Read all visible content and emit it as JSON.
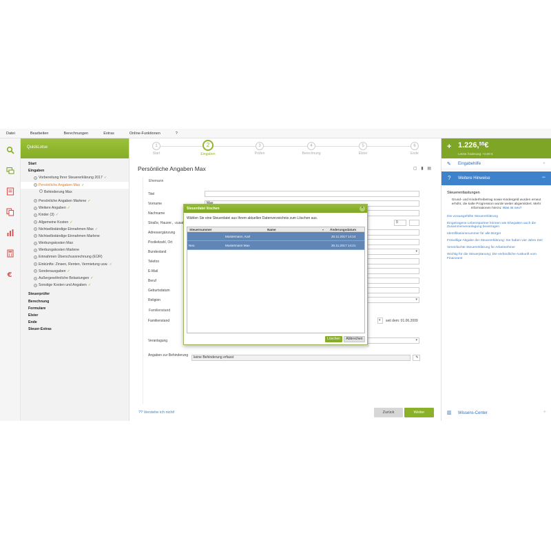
{
  "menu": [
    "Datei",
    "Bearbeiten",
    "Berechnungen",
    "Extras",
    "Online-Funktionen",
    "?"
  ],
  "rail_icons": [
    "search-icon",
    "chat-icon",
    "form-icon",
    "copy-icon",
    "chart-icon",
    "calculator-icon",
    "euro-icon"
  ],
  "tree": {
    "header": "QuickLotse",
    "items": [
      {
        "label": "Start",
        "type": "bold"
      },
      {
        "label": "Eingaben",
        "type": "bold"
      },
      {
        "label": "Vorbereitung Ihrer Steuererklärung 2017",
        "type": "sub",
        "check": true
      },
      {
        "label": "Persönliche Angaben Max",
        "type": "sub",
        "check": true,
        "selected": true
      },
      {
        "label": "Behinderung Max",
        "type": "sub2"
      },
      {
        "label": "Persönliche Angaben Marlene",
        "type": "sub",
        "check": true,
        "gap": true
      },
      {
        "label": "Weitere Angaben",
        "type": "sub",
        "check": true
      },
      {
        "label": "Kinder (3)",
        "type": "sub",
        "check": true
      },
      {
        "label": "Allgemeine Kosten",
        "type": "sub",
        "check": true
      },
      {
        "label": "Nichtselbständige Einnahmen Max",
        "type": "sub",
        "check": true
      },
      {
        "label": "Nichtselbständige Einnahmen Marlene",
        "type": "sub"
      },
      {
        "label": "Werbungskosten Max",
        "type": "sub"
      },
      {
        "label": "Werbungskosten Marlene",
        "type": "sub"
      },
      {
        "label": "Einnahmen Überschussrechnung (EÜR)",
        "type": "sub"
      },
      {
        "label": "Einkünfte: Zinsen, Renten, Vermietung usw.",
        "type": "sub",
        "check": true
      },
      {
        "label": "Sonderausgaben",
        "type": "sub",
        "check": true
      },
      {
        "label": "Außergewöhnliche Belastungen",
        "type": "sub",
        "check": true
      },
      {
        "label": "Sonstige Kosten und Angaben",
        "type": "sub",
        "check": true
      },
      {
        "label": "Steuerprüfer",
        "type": "bold",
        "gap": true
      },
      {
        "label": "Berechnung",
        "type": "bold"
      },
      {
        "label": "Formulare",
        "type": "bold"
      },
      {
        "label": "Elster",
        "type": "bold"
      },
      {
        "label": "Ende",
        "type": "bold"
      },
      {
        "label": "Steuer-Extras",
        "type": "bold"
      }
    ]
  },
  "steps": [
    {
      "num": "1",
      "label": "Start"
    },
    {
      "num": "2",
      "label": "Eingaben",
      "active": true
    },
    {
      "num": "3",
      "label": "Prüfen"
    },
    {
      "num": "4",
      "label": "Berechnung"
    },
    {
      "num": "5",
      "label": "Elster"
    },
    {
      "num": "6",
      "label": "Ende"
    }
  ],
  "page_title": "Persönliche Angaben Max",
  "form": {
    "section_ehemann": "Ehemann",
    "labels": [
      "Titel",
      "Vorname",
      "Nachname",
      "Straße, Hausnr., -zusatz",
      "Adressergänzung",
      "Postleitzahl, Ort",
      "Bundesland",
      "Telefon",
      "E-Mail",
      "Beruf",
      "Geburtsdatum",
      "Religion"
    ],
    "vorname_value": "Max",
    "hausnr_value": "0",
    "section_familienstand": "Familienstand",
    "familienstand_label": "Familienstand",
    "seit_text": "seit dem: 01.06.2009",
    "veranlagung_label": "Veranlagung",
    "behinderung_label": "Angaben zur Behinderung",
    "behinderung_value": "keine Behinderung erfasst"
  },
  "help_link": "Verstehe ich nicht!",
  "buttons": {
    "back": "Zurück",
    "next": "Weiter"
  },
  "refund": {
    "amount_main": "1.226,",
    "amount_cents": "55",
    "currency": "€",
    "last_change": "Letzte Änderung: +0,00 €"
  },
  "right": {
    "eingabehilfe": "Eingabehilfe",
    "weitere_hinweise": "Weitere Hinweise",
    "steuerentlastungen": "Steuerentlastungen",
    "paragraph": "Grund- und Kinderfreibetrag sowie Kindergeld wurden erneut erhöht, die kalte Progression wurde weiter abgemildert. Mehr Informationen hierzu:",
    "paragraph_link": "Was ist neu?",
    "links": [
      "Die vorausgefüllte Steuererklärung",
      "Eingetragene Lebenspartner können wie Ehegatten auch die Zusammenveranlagung beantragen",
      "Identifikationsnummer für alle Bürger",
      "Freiwillige Abgabe der Steuererklärung: Sie haben vier Jahre Zeit",
      "Vereinfachte Steuererklärung für Arbeitnehmer",
      "Wichtig für die Steuerplanung: Die verbindliche Auskunft vom Finanzamt"
    ],
    "wissen": "Wissens-Center"
  },
  "dialog": {
    "title": "Steuerdatei löschen",
    "text": "Wählen Sie eine Steuerdatei aus Ihrem aktuellen Datenverzeichnis zum Löschen aus.",
    "columns": [
      "Steuernummer",
      "Name",
      "Änderungsdatum"
    ],
    "rows": [
      {
        "steuernummer": "",
        "name": "Mustermann, Karl",
        "datum": "20.11.2017 14:14"
      },
      {
        "steuernummer": "Neu",
        "name": "Mustermann Max",
        "datum": "20.11.2017 14:21"
      }
    ],
    "delete_label": "Löschen",
    "cancel_label": "Abbrechen"
  },
  "colors": {
    "accent_green": "#86ad27",
    "hint_blue": "#3f82cc",
    "selected_orange": "#e07a1a",
    "row_blue": "#5f86b5"
  }
}
